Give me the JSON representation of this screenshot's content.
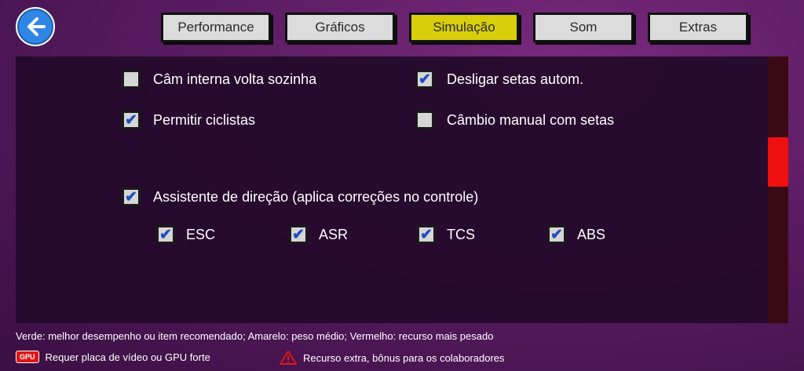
{
  "tabs": [
    {
      "label": "Performance",
      "active": false
    },
    {
      "label": "Gráficos",
      "active": false
    },
    {
      "label": "Simulação",
      "active": true
    },
    {
      "label": "Som",
      "active": false
    },
    {
      "label": "Extras",
      "active": false
    }
  ],
  "options": {
    "cam_interna": {
      "label": "Câm interna volta sozinha",
      "checked": false
    },
    "desligar_setas": {
      "label": "Desligar setas autom.",
      "checked": true
    },
    "permitir_ciclistas": {
      "label": "Permitir ciclistas",
      "checked": true
    },
    "cambio_manual": {
      "label": "Câmbio manual com setas",
      "checked": false
    },
    "assistente": {
      "label": "Assistente de direção (aplica correções no controle)",
      "checked": true
    },
    "esc": {
      "label": "ESC",
      "checked": true
    },
    "asr": {
      "label": "ASR",
      "checked": true
    },
    "tcs": {
      "label": "TCS",
      "checked": true
    },
    "abs": {
      "label": "ABS",
      "checked": true
    }
  },
  "footer": {
    "legend_text": "Verde: melhor desempenho ou item recomendado; Amarelo: peso médio; Vermelho: recurso mais pesado",
    "gpu_badge": "GPU",
    "gpu_text": "Requer placa de vídeo ou GPU forte",
    "extra_text": "Recurso extra, bônus para os colaboradores"
  },
  "checkmark": "✔",
  "colors": {
    "accent_tab": "#d8ce0c",
    "scroll_thumb": "#f00f0f",
    "check": "#1e4fbf",
    "back_button": "#2f86e6"
  }
}
